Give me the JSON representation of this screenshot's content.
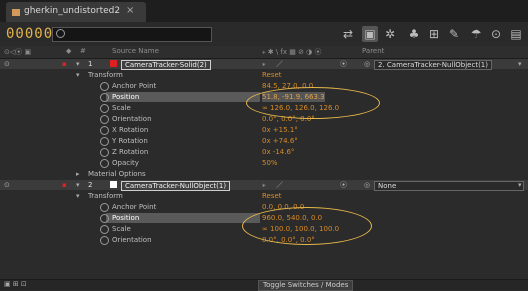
{
  "tab": {
    "title": "gherkin_undistorted2",
    "close": "×"
  },
  "toolbar": {
    "timecode": "00000",
    "search_placeholder": ""
  },
  "headers": {
    "source_name": "Source Name",
    "parent": "Parent",
    "switches": "⁎ ✱ \\ fx ▦ ⊘ ◑ ⦿",
    "hash": "#"
  },
  "layer1": {
    "num": "1",
    "name": "CameraTracker-Solid(2)",
    "color": "#e02020",
    "parent": "2. CameraTracker-NullObject(1)",
    "transform": "Transform",
    "reset": "Reset",
    "props": [
      {
        "label": "Anchor Point",
        "value": "84.5, 27.0, 0.0"
      },
      {
        "label": "Position",
        "value": "51.8, -91.9, 663.3"
      },
      {
        "label": "Scale",
        "value": "∞ 126.0, 126.0, 126.0"
      },
      {
        "label": "Orientation",
        "value": "0.0°, 0.0°, 0.0°"
      },
      {
        "label": "X Rotation",
        "value": "0x +15.1°"
      },
      {
        "label": "Y Rotation",
        "value": "0x +74.6°"
      },
      {
        "label": "Z Rotation",
        "value": "0x -14.6°"
      },
      {
        "label": "Opacity",
        "value": "50%"
      }
    ],
    "material": "Material Options"
  },
  "layer2": {
    "num": "2",
    "name": "CameraTracker-NullObject(1)",
    "color": "#ffffff",
    "parent": "None",
    "transform": "Transform",
    "reset": "Reset",
    "props": [
      {
        "label": "Anchor Point",
        "value": "0.0, 0.0, 0.0"
      },
      {
        "label": "Position",
        "value": "960.0, 540.0, 0.0"
      },
      {
        "label": "Scale",
        "value": "∞ 100.0, 100.0, 100.0"
      },
      {
        "label": "Orientation",
        "value": "0.0°, 0.0°, 0.0°"
      }
    ]
  },
  "bottom": {
    "toggle": "Toggle Switches / Modes"
  }
}
